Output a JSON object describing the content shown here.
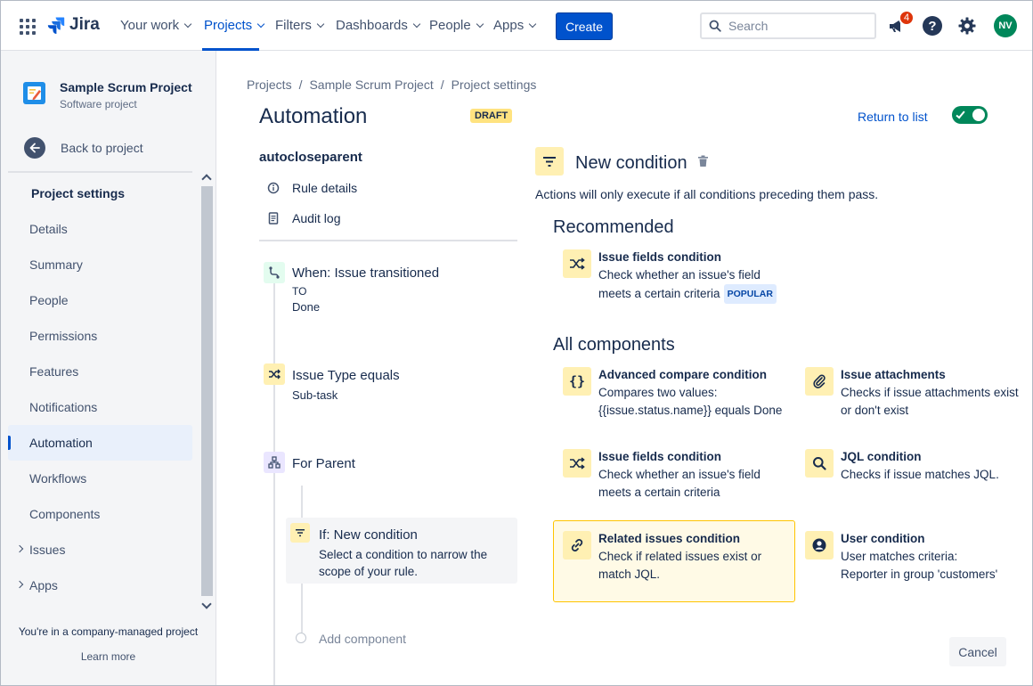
{
  "topnav": {
    "brand": "Jira",
    "items": [
      {
        "label": "Your work"
      },
      {
        "label": "Projects"
      },
      {
        "label": "Filters"
      },
      {
        "label": "Dashboards"
      },
      {
        "label": "People"
      },
      {
        "label": "Apps"
      }
    ],
    "active_item": "Projects",
    "create_label": "Create",
    "search_placeholder": "Search",
    "notification_count": "4",
    "avatar_initials": "NV"
  },
  "sidebar": {
    "project_name": "Sample Scrum Project",
    "project_type": "Software project",
    "back_label": "Back to project",
    "section_title": "Project settings",
    "items": [
      {
        "label": "Details"
      },
      {
        "label": "Summary"
      },
      {
        "label": "People"
      },
      {
        "label": "Permissions"
      },
      {
        "label": "Features"
      },
      {
        "label": "Notifications"
      },
      {
        "label": "Automation"
      },
      {
        "label": "Workflows"
      },
      {
        "label": "Components"
      },
      {
        "label": "Issues"
      },
      {
        "label": "Apps"
      }
    ],
    "selected_item": "Automation",
    "footer_text": "You're in a company-managed project",
    "footer_link": "Learn more"
  },
  "breadcrumb": [
    "Projects",
    "Sample Scrum Project",
    "Project settings"
  ],
  "page": {
    "title": "Automation",
    "status_badge": "DRAFT",
    "return_link": "Return to list",
    "rule_enabled": true
  },
  "rule": {
    "name": "autocloseparent",
    "links": [
      {
        "label": "Rule details",
        "icon": "info-icon"
      },
      {
        "label": "Audit log",
        "icon": "document-icon"
      }
    ],
    "trigger": {
      "title": "When: Issue transitioned",
      "line1": "TO",
      "line2": "Done"
    },
    "condition": {
      "title": "Issue Type equals",
      "sub": "Sub-task"
    },
    "branch": {
      "title": "For Parent"
    },
    "new_condition": {
      "title": "If: New condition",
      "desc_line1": "Select a condition to narrow the",
      "desc_line2": "scope of your rule."
    },
    "add_component": "Add component"
  },
  "panel": {
    "title": "New condition",
    "description": "Actions will only execute if all conditions preceding them pass.",
    "recommended_heading": "Recommended",
    "recommended": {
      "title": "Issue fields condition",
      "desc_line1": "Check whether an issue's field",
      "desc_line2": "meets a certain criteria",
      "badge": "POPULAR"
    },
    "all_heading": "All components",
    "components": [
      {
        "title": "Advanced compare condition",
        "desc_line1": "Compares two values:",
        "desc_line2": "{{issue.status.name}} equals Done",
        "icon": "braces-icon"
      },
      {
        "title": "Issue attachments",
        "desc_line1": "Checks if issue attachments exist",
        "desc_line2": "or don't exist",
        "icon": "paperclip-icon"
      },
      {
        "title": "Issue fields condition",
        "desc_line1": "Check whether an issue's field",
        "desc_line2": "meets a certain criteria",
        "icon": "shuffle-icon"
      },
      {
        "title": "JQL condition",
        "desc_line1": "Checks if issue matches JQL.",
        "desc_line2": "",
        "icon": "search-icon"
      },
      {
        "title": "Related issues condition",
        "desc_line1": "Check if related issues exist or",
        "desc_line2": "match JQL.",
        "icon": "link-icon"
      },
      {
        "title": "User condition",
        "desc_line1": "User matches criteria:",
        "desc_line2": "Reporter in group 'customers'",
        "icon": "user-icon"
      }
    ],
    "cancel_label": "Cancel"
  },
  "colors": {
    "brand_blue": "#0052cc",
    "toggle_green": "#00875a",
    "condition_yellow": "#fff0b3",
    "highlight_border": "#ffc400",
    "badge_red": "#de350b"
  }
}
